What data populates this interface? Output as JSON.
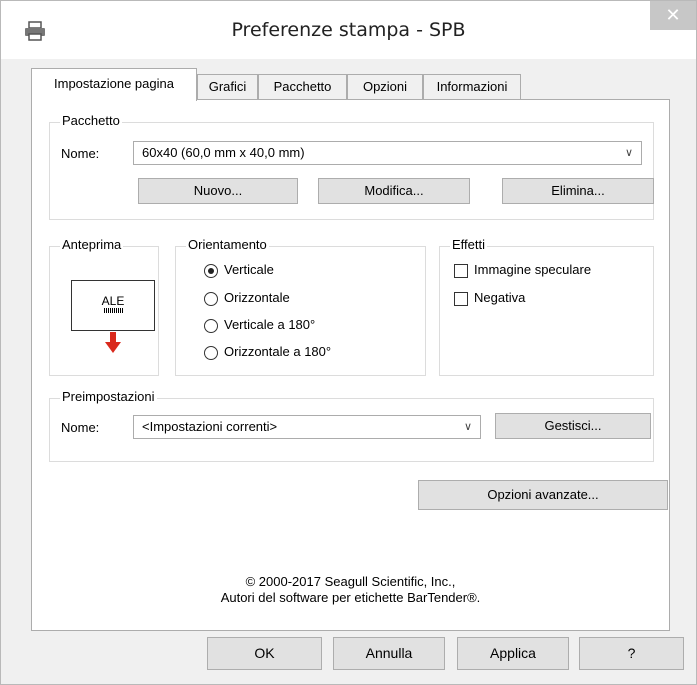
{
  "window": {
    "title": "Preferenze stampa - SPB",
    "close_glyph": "✕"
  },
  "tabs": [
    {
      "label": "Impostazione pagina"
    },
    {
      "label": "Grafici"
    },
    {
      "label": "Pacchetto"
    },
    {
      "label": "Opzioni"
    },
    {
      "label": "Informazioni"
    }
  ],
  "pacchetto": {
    "group_label": "Pacchetto",
    "name_label": "Nome:",
    "name_value": "60x40 (60,0 mm x 40,0 mm)",
    "buttons": {
      "new": "Nuovo...",
      "edit": "Modifica...",
      "delete": "Elimina..."
    }
  },
  "anteprima": {
    "group_label": "Anteprima",
    "preview_text": "ALE"
  },
  "orientamento": {
    "group_label": "Orientamento",
    "options": [
      {
        "label": "Verticale",
        "selected": true
      },
      {
        "label": "Orizzontale",
        "selected": false
      },
      {
        "label": "Verticale a 180°",
        "selected": false
      },
      {
        "label": "Orizzontale a 180°",
        "selected": false
      }
    ]
  },
  "effetti": {
    "group_label": "Effetti",
    "options": [
      {
        "label": "Immagine speculare",
        "checked": false
      },
      {
        "label": "Negativa",
        "checked": false
      }
    ]
  },
  "preimpostazioni": {
    "group_label": "Preimpostazioni",
    "name_label": "Nome:",
    "name_value": "<Impostazioni correnti>",
    "manage_label": "Gestisci..."
  },
  "advanced_label": "Opzioni avanzate...",
  "copyright": {
    "line1": "© 2000-2017 Seagull Scientific, Inc.,",
    "line2": "Autori del software per etichette BarTender®."
  },
  "footer": {
    "ok": "OK",
    "cancel": "Annulla",
    "apply": "Applica",
    "help": "?"
  },
  "icons": {
    "title": "printer-icon",
    "preview_arrow": "arrow-down-icon"
  },
  "colors": {
    "arrow": "#d9291c",
    "close_button": "#c7c7c7"
  }
}
